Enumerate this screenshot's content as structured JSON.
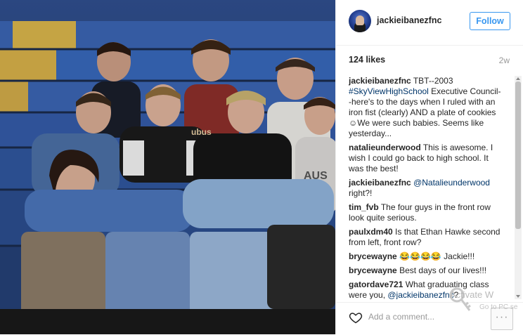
{
  "post": {
    "username": "jackieibanezfnc",
    "follow_label": "Follow",
    "likes": "124 likes",
    "time_ago": "2w",
    "add_comment_placeholder": "Add a comment...",
    "more_label": "···"
  },
  "caption": {
    "username": "jackieibanezfnc",
    "text_before": "TBT--2003",
    "hashtag": "#SkyViewHighSchool",
    "text_after": " Executive Council--here's to the days when I ruled with an iron fist (clearly) AND a plate of cookies ☺We were such babies. Seems like yesterday..."
  },
  "comments": [
    {
      "username": "natalieunderwood",
      "text": "This is awesome. I wish I could go back to high school. It was the best!"
    },
    {
      "username": "jackieibanezfnc",
      "mention": "@Natalieunderwood",
      "text": " right?!"
    },
    {
      "username": "tim_fvb",
      "text": "The four guys in the front row look quite serious."
    },
    {
      "username": "paulxdm40",
      "text": "Is that Ethan Hawke second from left, front row?"
    },
    {
      "username": "brycewayne",
      "text": "😂😂😂😂 Jackie!!!"
    },
    {
      "username": "brycewayne",
      "text": "Best days of our lives!!!"
    },
    {
      "username": "gatordave721",
      "text": "What graduating class were you, ",
      "mention": "@jackieibanezfnc",
      "text_end": "?"
    }
  ],
  "overlay": {
    "activate_title": "Activate W",
    "activate_sub": "Go to PC se"
  },
  "photo": {
    "shirt_text": "ubus",
    "shirt_text2": "AUS"
  },
  "icons": {
    "heart": "heart-icon",
    "more": "more-options-icon",
    "avatar": "avatar"
  },
  "colors": {
    "accent": "#3897f0",
    "link": "#003569",
    "bleachers_blue": "#3a63b0",
    "bleachers_yellow": "#d6b24a"
  }
}
